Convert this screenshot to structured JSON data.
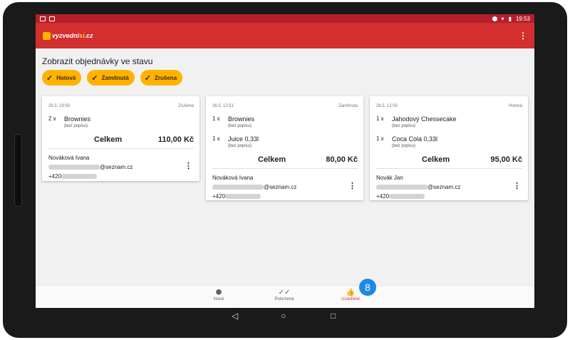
{
  "status_bar": {
    "time": "19:53"
  },
  "app": {
    "logo_prefix": "vyzvedni",
    "logo_accent": "si",
    "logo_suffix": ".cz",
    "menu_icon": "kebab-menu-icon"
  },
  "filter": {
    "title": "Zobrazit objednávky ve stavu",
    "chips": [
      {
        "label": "Hotová"
      },
      {
        "label": "Zamítnutá"
      },
      {
        "label": "Zrušena"
      }
    ]
  },
  "orders": [
    {
      "datetime": "26.5. 19:50",
      "status": "Zrušena",
      "items": [
        {
          "qty": "2 x",
          "name": "Brownies",
          "desc": "(bez popisu)"
        }
      ],
      "total_label": "Celkem",
      "total": "110,00 Kč",
      "customer": {
        "name": "Nováková Ivana",
        "email_suffix": "@seznam.cz",
        "phone_prefix": "+420"
      }
    },
    {
      "datetime": "26.5. 12:51",
      "status": "Zamítnuta",
      "items": [
        {
          "qty": "1 x",
          "name": "Brownies",
          "desc": "(bez popisu)"
        },
        {
          "qty": "1 x",
          "name": "Juice 0,33l",
          "desc": "(bez popisu)"
        }
      ],
      "total_label": "Celkem",
      "total": "80,00 Kč",
      "customer": {
        "name": "Nováková Ivana",
        "email_suffix": "@seznam.cz",
        "phone_prefix": "+420"
      }
    },
    {
      "datetime": "26.5. 12:50",
      "status": "Hotová",
      "items": [
        {
          "qty": "1 x",
          "name": "Jahodový Chessecake",
          "desc": "(bez popisu)"
        },
        {
          "qty": "1 x",
          "name": "Coca Cola 0,33l",
          "desc": "(bez popisu)"
        }
      ],
      "total_label": "Celkem",
      "total": "95,00 Kč",
      "customer": {
        "name": "Novák Jan",
        "email_suffix": "@seznam.cz",
        "phone_prefix": "+420"
      }
    }
  ],
  "bottom_nav": [
    {
      "label": "Nová",
      "icon": "alert-icon"
    },
    {
      "label": "Potvrzená",
      "icon": "double-check-icon"
    },
    {
      "label": "Uzavřené",
      "icon": "thumbs-up-icon"
    }
  ],
  "badge": {
    "count": "8"
  },
  "colors": {
    "primary": "#d32f2f",
    "status_bar": "#b3202a",
    "chip": "#ffb300",
    "badge": "#1e88e5"
  }
}
